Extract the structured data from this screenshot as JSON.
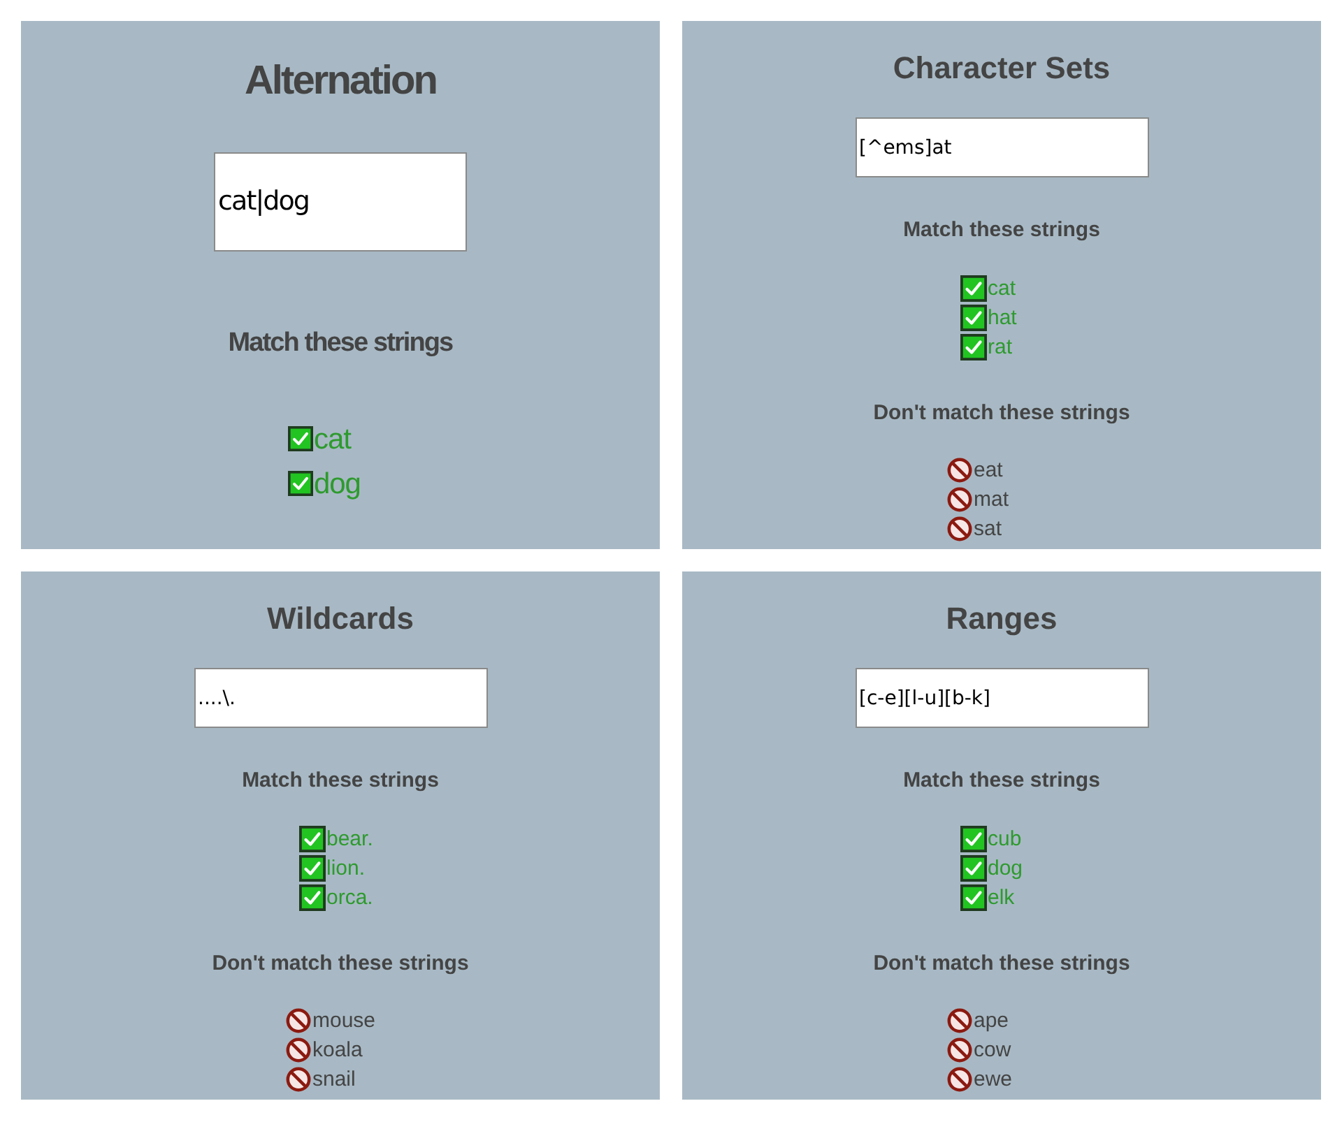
{
  "panels": [
    {
      "kind": "zoomed",
      "title": "Alternation",
      "input": {
        "value": "cat|dog"
      },
      "match_heading": "Match these strings",
      "match_items": [
        "cat",
        "dog"
      ]
    },
    {
      "kind": "normal",
      "title": "Character Sets",
      "input": {
        "value": "[^ems]at"
      },
      "match_heading": "Match these strings",
      "match_items": [
        "cat",
        "hat",
        "rat"
      ],
      "avoid_heading": "Don't match these strings",
      "avoid_items": [
        "eat",
        "mat",
        "sat"
      ]
    },
    {
      "kind": "normal",
      "title": "Wildcards",
      "input": {
        "value": "....\\."
      },
      "match_heading": "Match these strings",
      "match_items": [
        "bear.",
        "lion.",
        "orca."
      ],
      "avoid_heading": "Don't match these strings",
      "avoid_items": [
        "mouse",
        "koala",
        "snail"
      ]
    },
    {
      "kind": "normal",
      "title": "Ranges",
      "input": {
        "value": "[c-e][l-u][b-k]"
      },
      "match_heading": "Match these strings",
      "match_items": [
        "cub",
        "dog",
        "elk"
      ],
      "avoid_heading": "Don't match these strings",
      "avoid_items": [
        "ape",
        "cow",
        "ewe"
      ]
    }
  ]
}
